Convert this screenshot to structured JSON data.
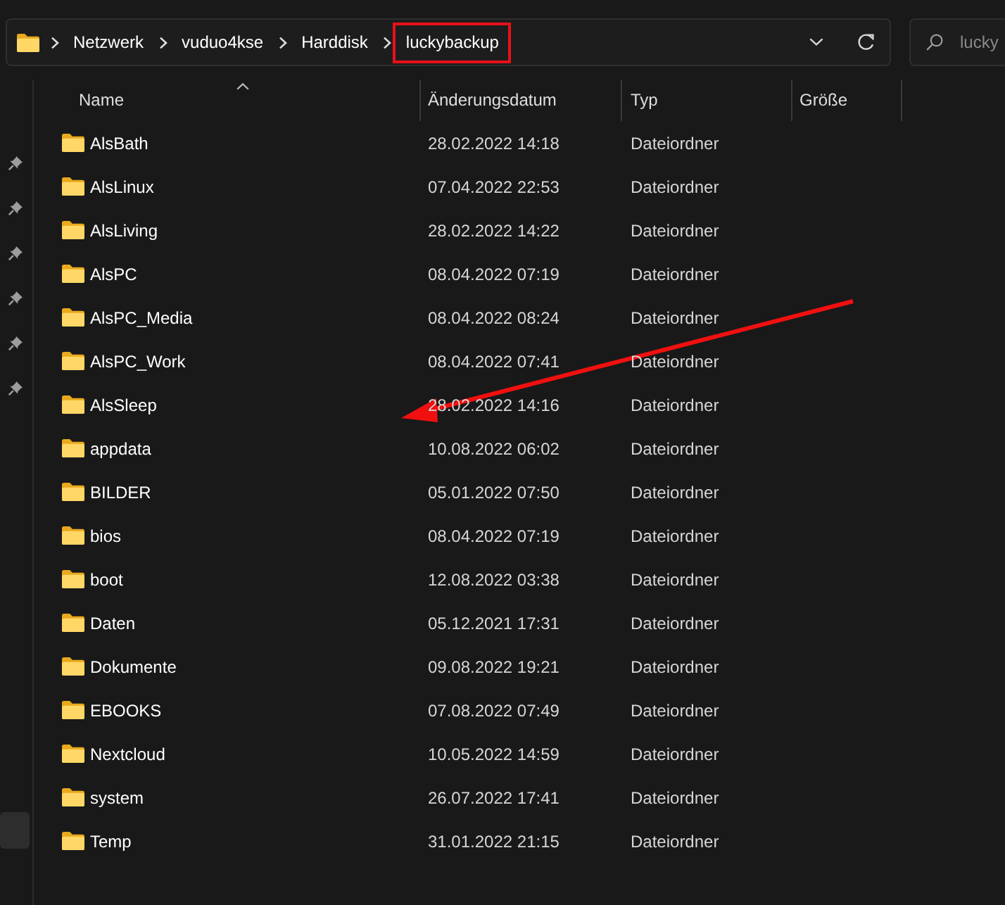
{
  "address_bar": {
    "breadcrumbs": [
      {
        "label": "Netzwerk",
        "highlighted": false
      },
      {
        "label": "vuduo4kse",
        "highlighted": false
      },
      {
        "label": "Harddisk",
        "highlighted": false
      },
      {
        "label": "luckybackup",
        "highlighted": true
      }
    ]
  },
  "search": {
    "placeholder": "lucky"
  },
  "navigation_pane": {
    "items": [
      {
        "kind": "pinned",
        "selected": false
      },
      {
        "kind": "pinned",
        "selected": false
      },
      {
        "kind": "pinned",
        "selected": false
      },
      {
        "kind": "pinned",
        "selected": false
      },
      {
        "kind": "pinned",
        "selected": false
      },
      {
        "kind": "pinned",
        "selected": false
      },
      {
        "kind": "plain",
        "selected": true
      }
    ]
  },
  "columns": [
    {
      "label": "Name",
      "sorted": true
    },
    {
      "label": "Änderungsdatum",
      "sorted": false
    },
    {
      "label": "Typ",
      "sorted": false
    },
    {
      "label": "Größe",
      "sorted": false
    }
  ],
  "rows": [
    {
      "name": "AlsBath",
      "modified": "28.02.2022 14:18",
      "type": "Dateiordner"
    },
    {
      "name": "AlsLinux",
      "modified": "07.04.2022 22:53",
      "type": "Dateiordner"
    },
    {
      "name": "AlsLiving",
      "modified": "28.02.2022 14:22",
      "type": "Dateiordner"
    },
    {
      "name": "AlsPC",
      "modified": "08.04.2022 07:19",
      "type": "Dateiordner"
    },
    {
      "name": "AlsPC_Media",
      "modified": "08.04.2022 08:24",
      "type": "Dateiordner"
    },
    {
      "name": "AlsPC_Work",
      "modified": "08.04.2022 07:41",
      "type": "Dateiordner"
    },
    {
      "name": "AlsSleep",
      "modified": "28.02.2022 14:16",
      "type": "Dateiordner"
    },
    {
      "name": "appdata",
      "modified": "10.08.2022 06:02",
      "type": "Dateiordner"
    },
    {
      "name": "BILDER",
      "modified": "05.01.2022 07:50",
      "type": "Dateiordner"
    },
    {
      "name": "bios",
      "modified": "08.04.2022 07:19",
      "type": "Dateiordner"
    },
    {
      "name": "boot",
      "modified": "12.08.2022 03:38",
      "type": "Dateiordner"
    },
    {
      "name": "Daten",
      "modified": "05.12.2021 17:31",
      "type": "Dateiordner"
    },
    {
      "name": "Dokumente",
      "modified": "09.08.2022 19:21",
      "type": "Dateiordner"
    },
    {
      "name": "EBOOKS",
      "modified": "07.08.2022 07:49",
      "type": "Dateiordner"
    },
    {
      "name": "Nextcloud",
      "modified": "10.05.2022 14:59",
      "type": "Dateiordner"
    },
    {
      "name": "system",
      "modified": "26.07.2022 17:41",
      "type": "Dateiordner"
    },
    {
      "name": "Temp",
      "modified": "31.01.2022 21:15",
      "type": "Dateiordner"
    }
  ],
  "annotations": [
    {
      "kind": "arrow"
    }
  ]
}
